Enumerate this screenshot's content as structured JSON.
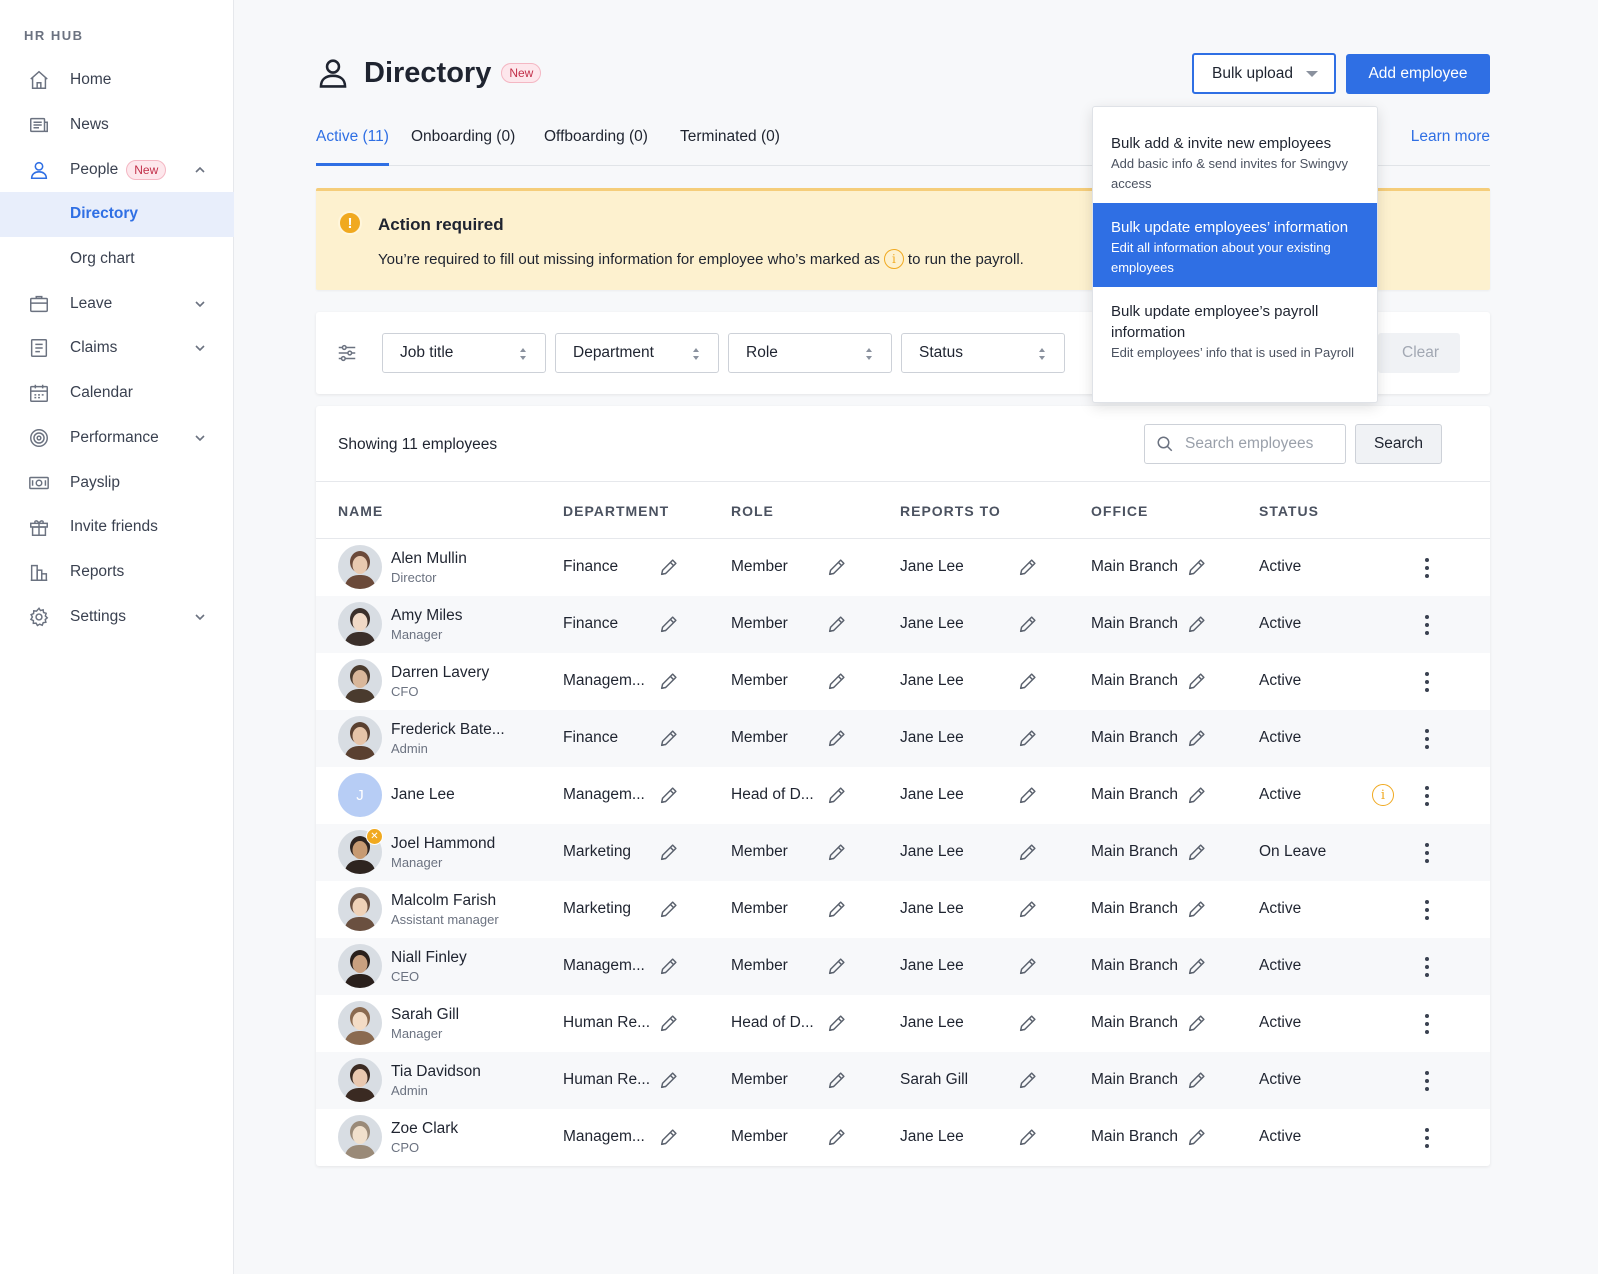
{
  "brand": "HR HUB",
  "nav": {
    "home": "Home",
    "news": "News",
    "people": "People",
    "people_badge": "New",
    "directory": "Directory",
    "org_chart": "Org chart",
    "leave": "Leave",
    "claims": "Claims",
    "calendar": "Calendar",
    "performance": "Performance",
    "payslip": "Payslip",
    "invite_friends": "Invite friends",
    "reports": "Reports",
    "settings": "Settings"
  },
  "page": {
    "title": "Directory",
    "badge": "New",
    "bulk_upload": "Bulk upload",
    "add_employee": "Add employee",
    "learn_more": "Learn more"
  },
  "tabs": [
    {
      "label": "Active (11)"
    },
    {
      "label": "Onboarding (0)"
    },
    {
      "label": "Offboarding (0)"
    },
    {
      "label": "Terminated (0)"
    }
  ],
  "alert": {
    "icon": "!",
    "title": "Action required",
    "text_before": "You’re required to fill out missing information for employee who’s marked as",
    "text_after": "to run the payroll."
  },
  "filters": {
    "job_title": "Job title",
    "department": "Department",
    "role": "Role",
    "status": "Status",
    "clear": "Clear"
  },
  "table": {
    "showing": "Showing 11 employees",
    "search_placeholder": "Search employees",
    "search_button": "Search",
    "headers": {
      "name": "NAME",
      "department": "DEPARTMENT",
      "role": "ROLE",
      "reports_to": "REPORTS TO",
      "office": "OFFICE",
      "status": "STATUS"
    },
    "rows": [
      {
        "name": "Alen Mullin",
        "title": "Director",
        "department": "Finance",
        "role": "Member",
        "reports_to": "Jane Lee",
        "office": "Main Branch",
        "status": "Active"
      },
      {
        "name": "Amy Miles",
        "title": "Manager",
        "department": "Finance",
        "role": "Member",
        "reports_to": "Jane Lee",
        "office": "Main Branch",
        "status": "Active"
      },
      {
        "name": "Darren Lavery",
        "title": "CFO",
        "department": "Managem...",
        "role": "Member",
        "reports_to": "Jane Lee",
        "office": "Main Branch",
        "status": "Active"
      },
      {
        "name": "Frederick Bate...",
        "title": "Admin",
        "department": "Finance",
        "role": "Member",
        "reports_to": "Jane Lee",
        "office": "Main Branch",
        "status": "Active"
      },
      {
        "name": "Jane Lee",
        "title": "",
        "initial": "J",
        "department": "Managem...",
        "role": "Head of D...",
        "reports_to": "Jane Lee",
        "office": "Main Branch",
        "status": "Active",
        "info": "i"
      },
      {
        "name": "Joel Hammond",
        "title": "Manager",
        "department": "Marketing",
        "role": "Member",
        "reports_to": "Jane Lee",
        "office": "Main Branch",
        "status": "On Leave",
        "warn": "✕"
      },
      {
        "name": "Malcolm Farish",
        "title": "Assistant manager",
        "department": "Marketing",
        "role": "Member",
        "reports_to": "Jane Lee",
        "office": "Main Branch",
        "status": "Active"
      },
      {
        "name": "Niall Finley",
        "title": "CEO",
        "department": "Managem...",
        "role": "Member",
        "reports_to": "Jane Lee",
        "office": "Main Branch",
        "status": "Active"
      },
      {
        "name": "Sarah Gill",
        "title": "Manager",
        "department": "Human Re...",
        "role": "Head of D...",
        "reports_to": "Jane Lee",
        "office": "Main Branch",
        "status": "Active"
      },
      {
        "name": "Tia Davidson",
        "title": "Admin",
        "department": "Human Re...",
        "role": "Member",
        "reports_to": "Sarah Gill",
        "office": "Main Branch",
        "status": "Active"
      },
      {
        "name": "Zoe Clark",
        "title": "CPO",
        "department": "Managem...",
        "role": "Member",
        "reports_to": "Jane Lee",
        "office": "Main Branch",
        "status": "Active"
      }
    ]
  },
  "dropdown": {
    "items": [
      {
        "title": "Bulk add & invite new employees",
        "desc": "Add basic info & send invites for Swingvy access"
      },
      {
        "title": "Bulk update employees’ information",
        "desc": "Edit all information about your existing employees"
      },
      {
        "title": "Bulk update employee’s payroll information",
        "desc": "Edit employees’ info that is used in Payroll"
      }
    ]
  },
  "colors": {
    "accent": "#2f6fe4",
    "warning": "#f0a920",
    "alert_bg": "#fdf1cf",
    "badge_bg": "#fde7ec",
    "badge_text": "#c2304a"
  }
}
